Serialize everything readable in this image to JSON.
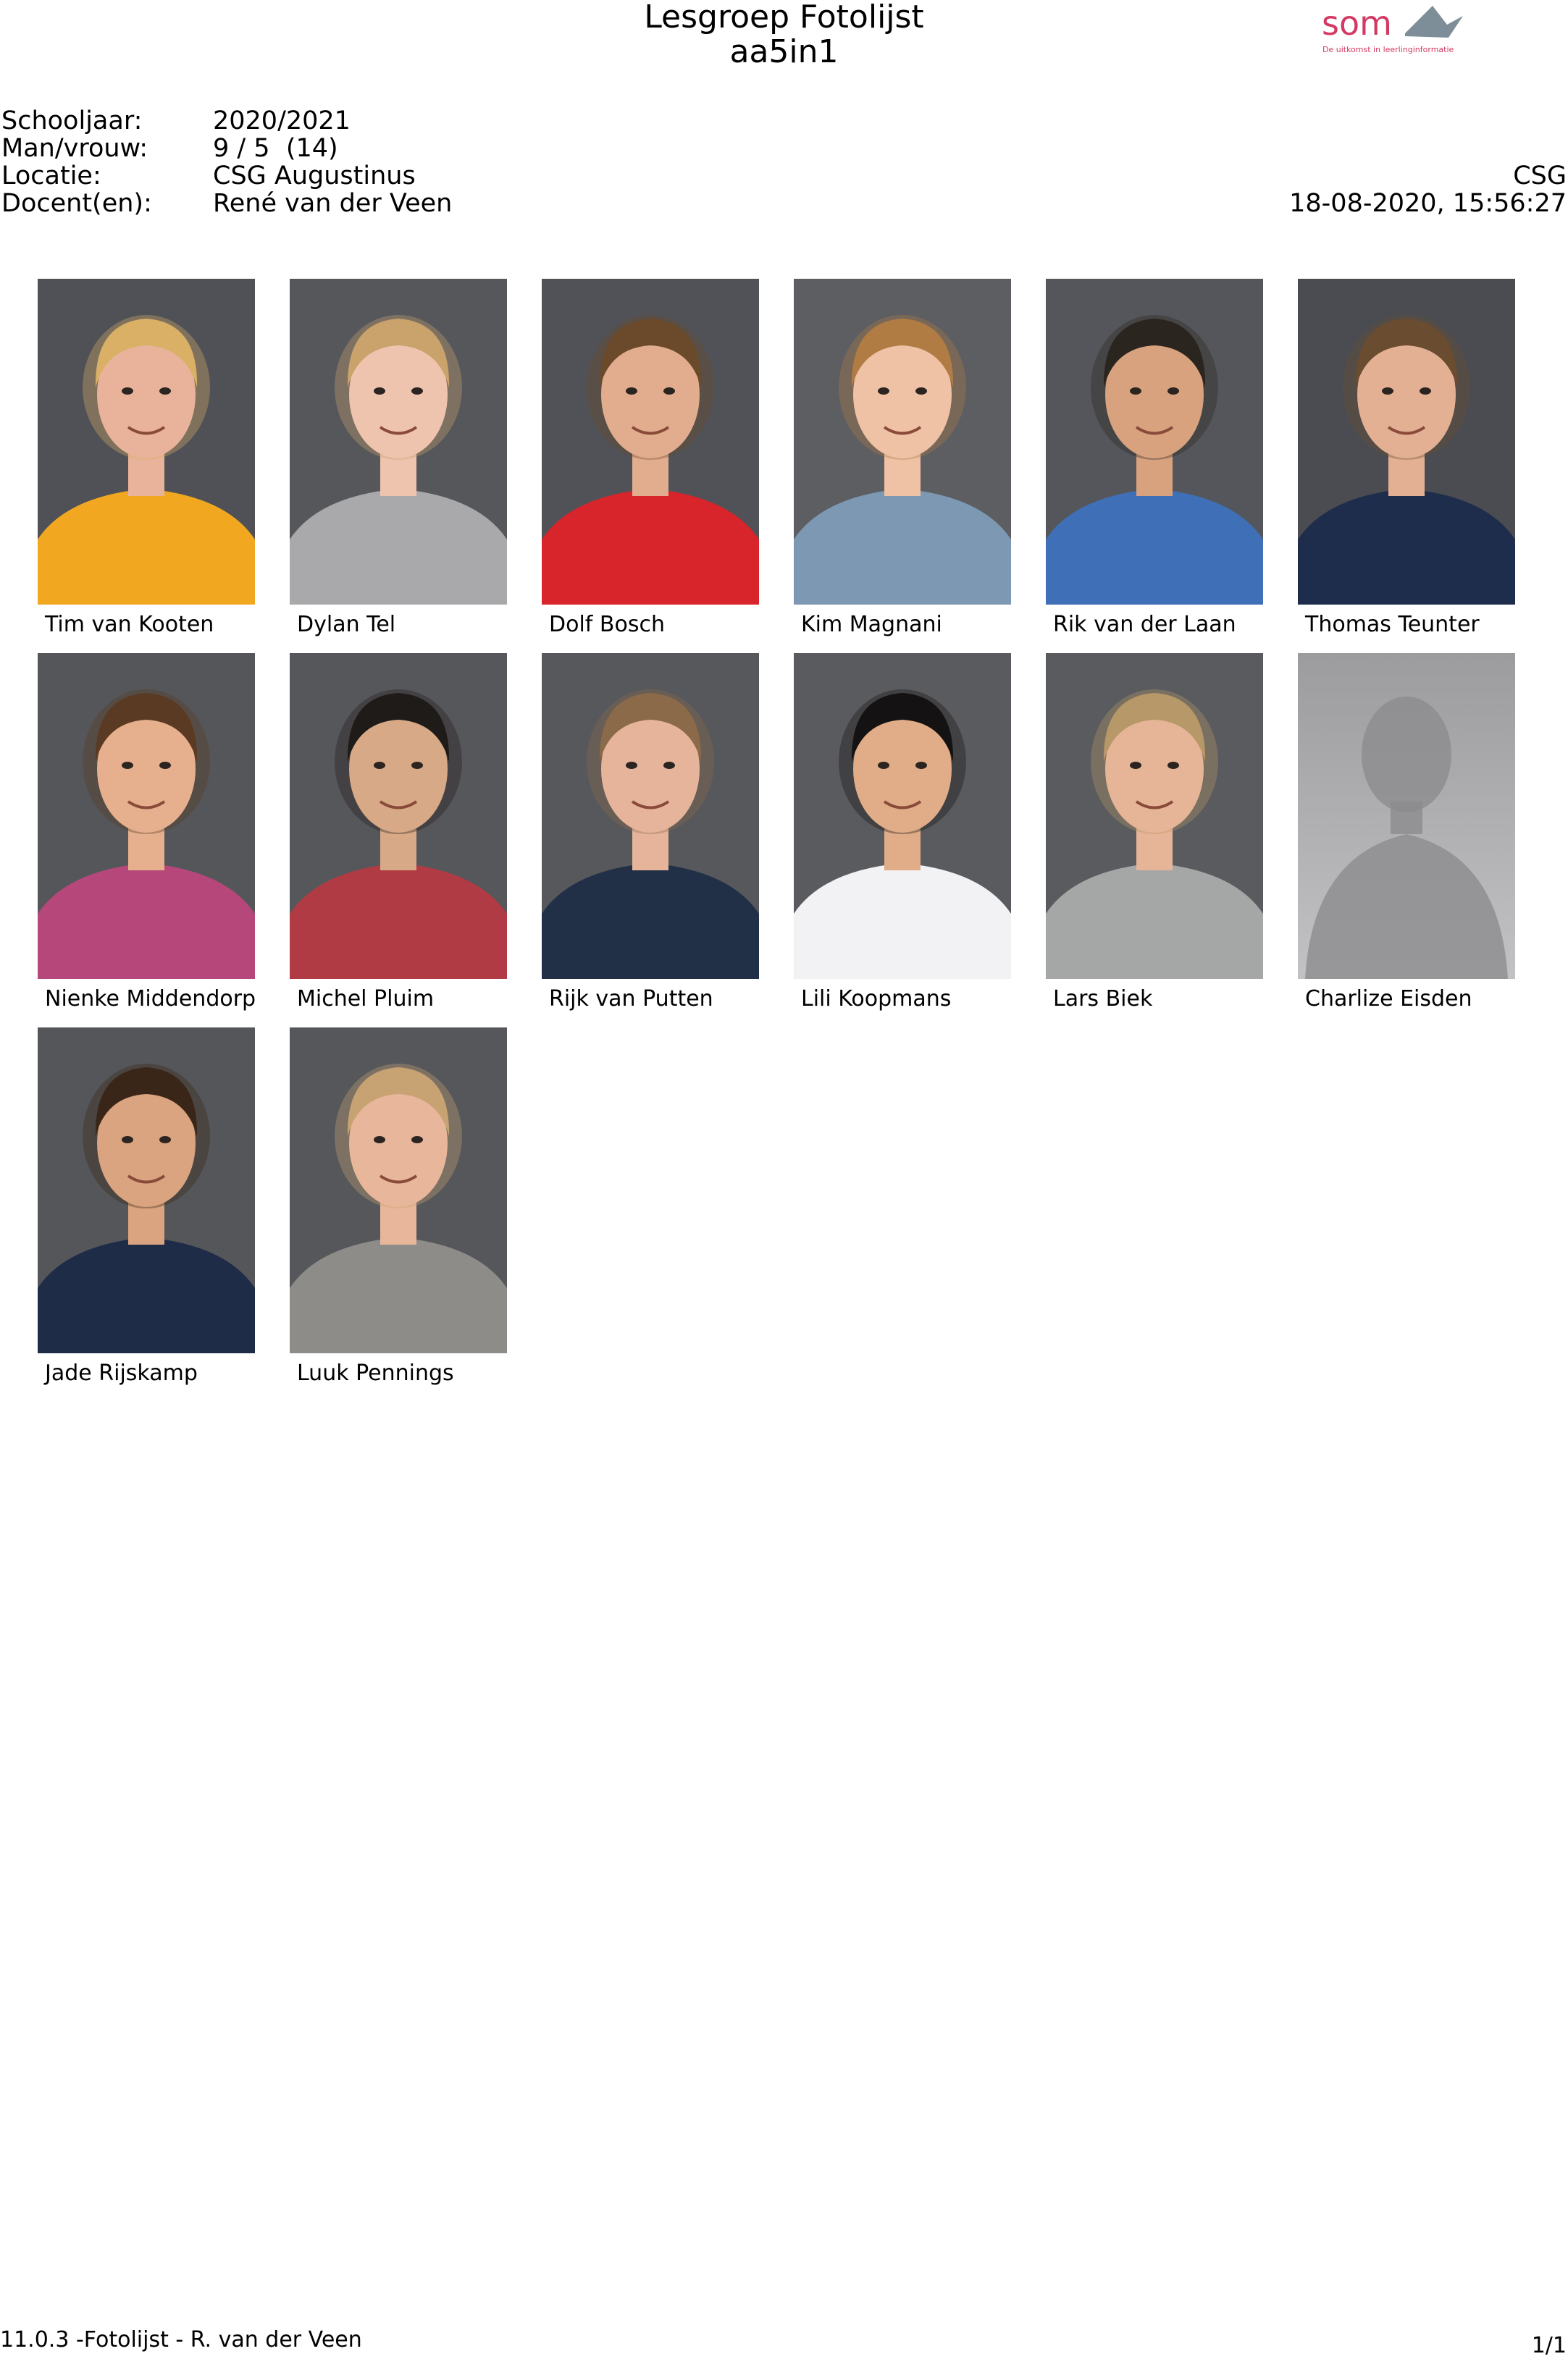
{
  "header": {
    "title": "Lesgroep Fotolijst",
    "subtitle": "aa5in1",
    "logo": {
      "text": "som",
      "tagline": "De uitkomst in leerlinginformatie"
    }
  },
  "info": {
    "labels": [
      "Schooljaar:",
      "Man/vrouw:",
      "Locatie:",
      "Docent(en):"
    ],
    "values": [
      "2020/2021",
      "9 / 5  (14)",
      "CSG Augustinus",
      "René van der Veen"
    ],
    "school_short": "CSG",
    "datetime": "18-08-2020, 15:56:27"
  },
  "students": [
    {
      "name": "Tim van Kooten",
      "bg": "#4f5156",
      "skin": "#e8b39a",
      "hair": "#d9b066",
      "shirt": "#f1a820",
      "placeholder": false
    },
    {
      "name": "Dylan Tel",
      "bg": "#56575b",
      "skin": "#efc4ae",
      "hair": "#c9a26c",
      "shirt": "#a9a9ab",
      "placeholder": false
    },
    {
      "name": "Dolf Bosch",
      "bg": "#515257",
      "skin": "#e2ad8e",
      "hair": "#6b4a2c",
      "shirt": "#d8242b",
      "placeholder": false
    },
    {
      "name": "Kim Magnani",
      "bg": "#5d5e62",
      "skin": "#efc2a6",
      "hair": "#b07c44",
      "shirt": "#7d98b3",
      "placeholder": false
    },
    {
      "name": "Rik van der Laan",
      "bg": "#55565b",
      "skin": "#d9a27f",
      "hair": "#2b2520",
      "shirt": "#3f6fb7",
      "placeholder": false
    },
    {
      "name": "Thomas Teunter",
      "bg": "#4b4c51",
      "skin": "#e3b094",
      "hair": "#6a4c30",
      "shirt": "#1f2d4d",
      "placeholder": false
    },
    {
      "name": "Nienke Middendorp",
      "bg": "#55565a",
      "skin": "#e6b08e",
      "hair": "#5a3a22",
      "shirt": "#b6477a",
      "placeholder": false
    },
    {
      "name": "Michel Pluim",
      "bg": "#56575b",
      "skin": "#d8a987",
      "hair": "#1f1b18",
      "shirt": "#b13b44",
      "placeholder": false
    },
    {
      "name": "Rijk van Putten",
      "bg": "#57585c",
      "skin": "#e6b49a",
      "hair": "#8a6a48",
      "shirt": "#223047",
      "placeholder": false
    },
    {
      "name": "Lili Koopmans",
      "bg": "#5a5b5f",
      "skin": "#e0ad88",
      "hair": "#141212",
      "shirt": "#f2f2f4",
      "placeholder": false
    },
    {
      "name": "Lars Biek",
      "bg": "#5a5b5f",
      "skin": "#e6b597",
      "hair": "#b79868",
      "shirt": "#a5a6a6",
      "placeholder": false
    },
    {
      "name": "Charlize Eisden",
      "bg": "#a9a9ab",
      "skin": "#8c8c8e",
      "hair": "#8c8c8e",
      "shirt": "#8c8c8e",
      "placeholder": true
    },
    {
      "name": "Jade Rijskamp",
      "bg": "#55565a",
      "skin": "#d9a47f",
      "hair": "#3a2618",
      "shirt": "#1e2c48",
      "placeholder": false
    },
    {
      "name": "Luuk Pennings",
      "bg": "#56575b",
      "skin": "#e8b79b",
      "hair": "#c7a373",
      "shirt": "#8d8c89",
      "placeholder": false
    }
  ],
  "footer": {
    "left": "11.0.3 -Fotolijst - R. van der Veen",
    "right": "1/1"
  },
  "colors": {
    "logo_text": "#d33a63",
    "logo_icon": "#7e8e99"
  }
}
